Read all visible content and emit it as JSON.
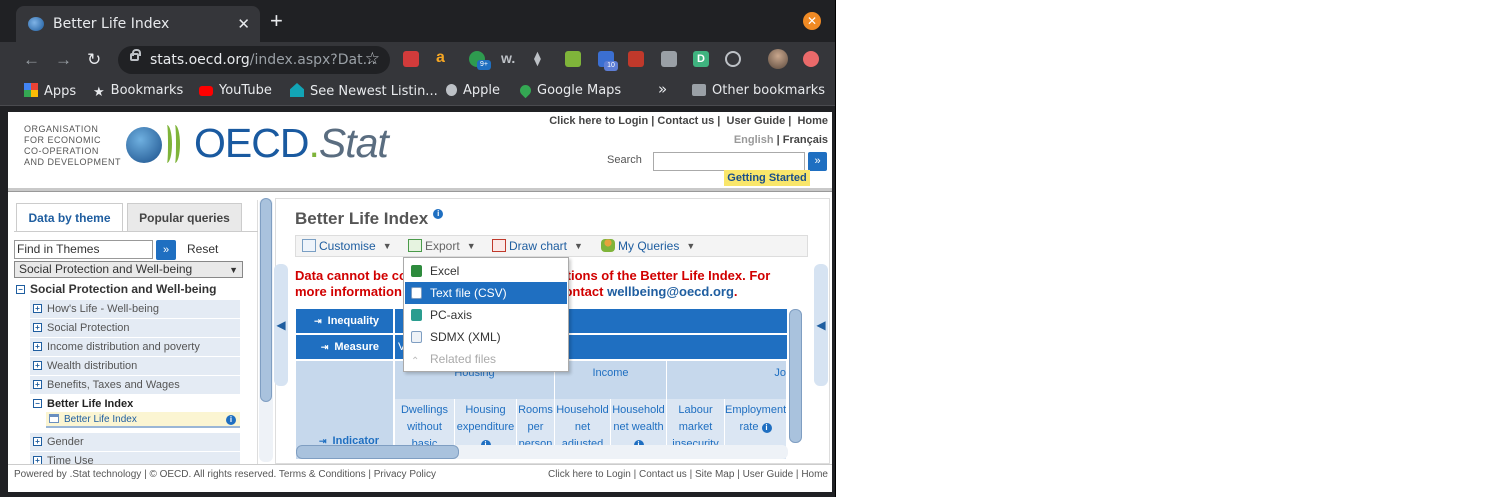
{
  "browser": {
    "tab_title": "Better Life Index",
    "tab_close": "✕",
    "new_tab": "+",
    "url_host": "stats.oecd.org",
    "url_path": "/index.aspx?Dat...",
    "profile_badge_count": "9+",
    "calendar_badge": "10",
    "bookmarks": [
      {
        "label": "Apps",
        "icon": "apps-grid-icon"
      },
      {
        "label": "Bookmarks",
        "icon": "star-icon"
      },
      {
        "label": "YouTube",
        "icon": "youtube-icon"
      },
      {
        "label": "See Newest Listin...",
        "icon": "house-icon"
      },
      {
        "label": "Apple",
        "icon": "apple-icon"
      },
      {
        "label": "Google Maps",
        "icon": "map-pin-icon"
      },
      {
        "label": "Other bookmarks",
        "icon": "folder-icon"
      }
    ],
    "overflow": "»"
  },
  "header": {
    "org_text": "ORGANISATION\nFOR ECONOMIC\nCO-OPERATION\nAND DEVELOPMENT",
    "logo_main": "OECD",
    "logo_dot": ".",
    "logo_stat": "Stat",
    "links": [
      "Click here to Login",
      "Contact us",
      "User Guide",
      "Home"
    ],
    "lang_en": "English",
    "lang_fr": "Français",
    "search_label": "Search",
    "search_value": "",
    "getting_started": "Getting Started"
  },
  "left": {
    "tabs": [
      "Data by theme",
      "Popular queries"
    ],
    "find_placeholder": "Find in Themes",
    "reset": "Reset",
    "theme_selected": "Social Protection and Well-being",
    "root": "Social Protection and Well-being",
    "items": [
      "How's Life - Well-being",
      "Social Protection",
      "Income distribution and poverty",
      "Wealth distribution",
      "Benefits, Taxes and Wages",
      "Better Life Index",
      "Gender",
      "Time Use"
    ],
    "leaf": "Better Life Index"
  },
  "main": {
    "title": "Better Life Index",
    "menu": [
      "Customise",
      "Export",
      "Draw chart",
      "My Queries"
    ],
    "notice_part1": "Data cannot be co",
    "notice_part2": "editions of the Better Life Index. For",
    "notice_part3": "more information",
    "notice_part4": "se contact",
    "notice_email": "wellbeing@oecd.org",
    "grid": {
      "row_inequality": "Inequality",
      "row_measure": "Measure",
      "measure_value": "V",
      "row_indicator": "Indicator",
      "categories": [
        "Housing",
        "Income",
        "Jo"
      ],
      "subheaders": [
        "Dwellings without basic",
        "Housing expenditure",
        "Rooms per person",
        "Household net adjusted",
        "Household net wealth",
        "Labour market insecurity",
        "Employment rate"
      ]
    },
    "export_menu": [
      {
        "label": "Excel",
        "state": "normal"
      },
      {
        "label": "Text file (CSV)",
        "state": "selected"
      },
      {
        "label": "PC-axis",
        "state": "normal"
      },
      {
        "label": "SDMX (XML)",
        "state": "normal"
      },
      {
        "label": "Related files",
        "state": "disabled"
      }
    ]
  },
  "footer": {
    "left": "Powered by .Stat technology | © OECD. All rights reserved. Terms & Conditions | Privacy Policy",
    "right": "Click here to Login | Contact us | Site Map | User Guide | Home"
  },
  "colors": {
    "oecd_blue": "#1f6fc1",
    "alert_red": "#d10000",
    "getting_started_bg": "#f9e66b"
  }
}
